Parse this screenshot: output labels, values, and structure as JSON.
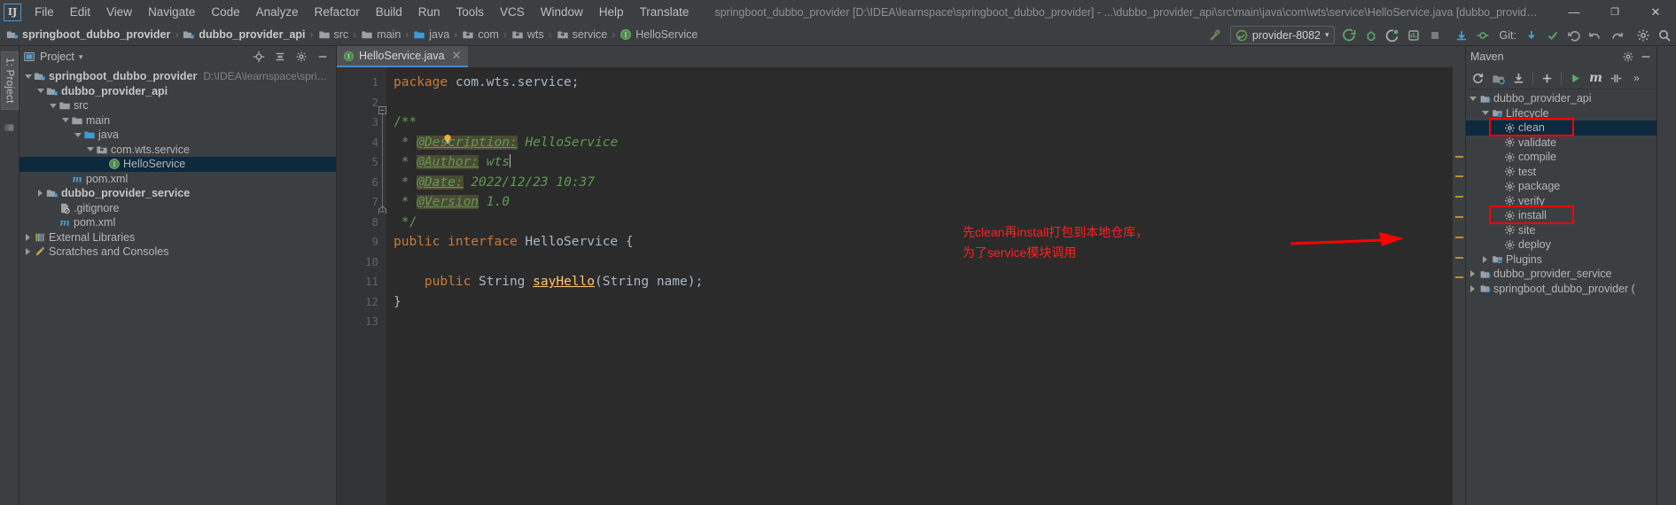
{
  "window": {
    "title": "springboot_dubbo_provider [D:\\IDEA\\learnspace\\springboot_dubbo_provider] - ...\\dubbo_provider_api\\src\\main\\java\\com\\wts\\service\\HelloService.java [dubbo_provider_api]",
    "logo": "IJ",
    "minimize": "—",
    "maximize": "❐",
    "close": "✕"
  },
  "menubar": {
    "items": [
      {
        "label": "File"
      },
      {
        "label": "Edit"
      },
      {
        "label": "View"
      },
      {
        "label": "Navigate"
      },
      {
        "label": "Code"
      },
      {
        "label": "Analyze"
      },
      {
        "label": "Refactor"
      },
      {
        "label": "Build"
      },
      {
        "label": "Run"
      },
      {
        "label": "Tools"
      },
      {
        "label": "VCS"
      },
      {
        "label": "Window"
      },
      {
        "label": "Help"
      },
      {
        "label": "Translate"
      }
    ]
  },
  "navbar": {
    "crumbs": [
      {
        "label": "springboot_dubbo_provider",
        "icon": "module-icon",
        "bold": true
      },
      {
        "label": "dubbo_provider_api",
        "icon": "module-icon",
        "bold": true
      },
      {
        "label": "src",
        "icon": "folder-icon",
        "bold": false
      },
      {
        "label": "main",
        "icon": "folder-icon",
        "bold": false
      },
      {
        "label": "java",
        "icon": "source-folder-icon",
        "bold": false
      },
      {
        "label": "com",
        "icon": "package-icon",
        "bold": false
      },
      {
        "label": "wts",
        "icon": "package-icon",
        "bold": false
      },
      {
        "label": "service",
        "icon": "package-icon",
        "bold": false
      },
      {
        "label": "HelloService",
        "icon": "interface-icon",
        "bold": false
      }
    ],
    "separator": "›",
    "run_config": {
      "label": "provider-8082",
      "icon": "spring-boot-icon",
      "dropdown": "▾"
    },
    "git_label": "Git:",
    "icons": [
      "build-project-icon",
      "run-icon",
      "debug-icon",
      "run-with-coverage-icon",
      "profile-icon",
      "stop-icon",
      "update-project-icon",
      "commit-icon",
      "rollback-icon",
      "undo-icon",
      "redo-icon",
      "open-settings-icon",
      "search-everywhere-icon"
    ]
  },
  "left_rail": {
    "tab": "1: Project",
    "structure_icon": "structure-icon"
  },
  "project_panel": {
    "title": "Project",
    "dropdown": "▾",
    "header_icons": [
      "locate-icon",
      "collapse-all-icon",
      "settings-gear-icon",
      "hide-icon"
    ],
    "tree": [
      {
        "label": "springboot_dubbo_provider",
        "sub": "D:\\IDEA\\learnspace\\springboot_dubbo...",
        "depth": 0,
        "twisty": "down",
        "icon": "module-icon",
        "bold": true,
        "selected": false
      },
      {
        "label": "dubbo_provider_api",
        "sub": "",
        "depth": 1,
        "twisty": "down",
        "icon": "module-icon",
        "bold": true,
        "selected": false
      },
      {
        "label": "src",
        "sub": "",
        "depth": 2,
        "twisty": "down",
        "icon": "folder-icon",
        "bold": false,
        "selected": false
      },
      {
        "label": "main",
        "sub": "",
        "depth": 3,
        "twisty": "down",
        "icon": "folder-icon",
        "bold": false,
        "selected": false
      },
      {
        "label": "java",
        "sub": "",
        "depth": 4,
        "twisty": "down",
        "icon": "source-folder-icon",
        "bold": false,
        "selected": false
      },
      {
        "label": "com.wts.service",
        "sub": "",
        "depth": 5,
        "twisty": "down",
        "icon": "package-icon",
        "bold": false,
        "selected": false
      },
      {
        "label": "HelloService",
        "sub": "",
        "depth": 6,
        "twisty": "none",
        "icon": "interface-icon",
        "bold": false,
        "selected": true
      },
      {
        "label": "pom.xml",
        "sub": "",
        "depth": 3,
        "twisty": "none",
        "icon": "maven-file-icon",
        "bold": false,
        "selected": false
      },
      {
        "label": "dubbo_provider_service",
        "sub": "",
        "depth": 1,
        "twisty": "right",
        "icon": "module-icon",
        "bold": true,
        "selected": false
      },
      {
        "label": ".gitignore",
        "sub": "",
        "depth": 2,
        "twisty": "none",
        "icon": "gitignore-icon",
        "bold": false,
        "selected": false
      },
      {
        "label": "pom.xml",
        "sub": "",
        "depth": 2,
        "twisty": "none",
        "icon": "maven-file-icon",
        "bold": false,
        "selected": false
      },
      {
        "label": "External Libraries",
        "sub": "",
        "depth": 0,
        "twisty": "right",
        "icon": "library-icon",
        "bold": false,
        "selected": false
      },
      {
        "label": "Scratches and Consoles",
        "sub": "",
        "depth": 0,
        "twisty": "right",
        "icon": "scratches-icon",
        "bold": false,
        "selected": false
      }
    ]
  },
  "editor": {
    "tab": {
      "label": "HelloService.java",
      "icon": "interface-icon",
      "close": "✕"
    },
    "line_numbers": [
      "1",
      "2",
      "3",
      "4",
      "5",
      "6",
      "7",
      "8",
      "9",
      "10",
      "11",
      "12",
      "13"
    ],
    "code_lines": [
      {
        "n": 1,
        "segments": [
          {
            "t": "package ",
            "c": "kw"
          },
          {
            "t": "com.wts.service;",
            "c": "txt"
          }
        ]
      },
      {
        "n": 2,
        "segments": []
      },
      {
        "n": 3,
        "segments": [
          {
            "t": "/**",
            "c": "cm"
          }
        ]
      },
      {
        "n": 4,
        "segments": [
          {
            "t": " * ",
            "c": "cm"
          },
          {
            "t": "@Description:",
            "c": "cmu"
          },
          {
            "t": " ",
            "c": "cm"
          },
          {
            "t": "HelloService",
            "c": "cmi"
          }
        ]
      },
      {
        "n": 5,
        "segments": [
          {
            "t": " * ",
            "c": "cm"
          },
          {
            "t": "@Author:",
            "c": "cmu"
          },
          {
            "t": " ",
            "c": "cm"
          },
          {
            "t": "wts",
            "c": "cmi"
          }
        ]
      },
      {
        "n": 6,
        "segments": [
          {
            "t": " * ",
            "c": "cm"
          },
          {
            "t": "@Date:",
            "c": "cmu"
          },
          {
            "t": " ",
            "c": "cm"
          },
          {
            "t": "2022/12/23 10:37",
            "c": "cmi"
          }
        ]
      },
      {
        "n": 7,
        "segments": [
          {
            "t": " * ",
            "c": "cm"
          },
          {
            "t": "@Version",
            "c": "cmu"
          },
          {
            "t": " ",
            "c": "cm"
          },
          {
            "t": "1.0",
            "c": "cmi"
          }
        ]
      },
      {
        "n": 8,
        "segments": [
          {
            "t": " */",
            "c": "cm"
          }
        ]
      },
      {
        "n": 9,
        "segments": [
          {
            "t": "public interface ",
            "c": "kw"
          },
          {
            "t": "HelloService {",
            "c": "txt"
          }
        ]
      },
      {
        "n": 10,
        "segments": []
      },
      {
        "n": 11,
        "segments": [
          {
            "t": "    ",
            "c": "txt"
          },
          {
            "t": "public ",
            "c": "kw"
          },
          {
            "t": "String ",
            "c": "txt"
          },
          {
            "t": "sayHello",
            "c": "mth"
          },
          {
            "t": "(",
            "c": "txt"
          },
          {
            "t": "String ",
            "c": "txt"
          },
          {
            "t": "name);",
            "c": "txt"
          }
        ]
      },
      {
        "n": 12,
        "segments": [
          {
            "t": "}",
            "c": "txt"
          }
        ]
      },
      {
        "n": 13,
        "segments": []
      }
    ],
    "intention_bulb": "lightbulb-icon",
    "caret_line": 5,
    "annotation": {
      "line1": "先clean再install打包到本地仓库，",
      "line2": "为了service模块调用",
      "color": "#ff1f1f"
    }
  },
  "maven_panel": {
    "title": "Maven",
    "header_icons": [
      "settings-gear-icon",
      "hide-icon"
    ],
    "toolbar_icons": [
      "reload-icon",
      "generate-sources-icon",
      "download-sources-icon",
      "add-maven-project-icon",
      "run-maven-goal-icon",
      "maven-settings-icon",
      "toggle-offline-icon",
      "more-icon"
    ],
    "tree": [
      {
        "label": "dubbo_provider_api",
        "depth": 0,
        "twisty": "down",
        "icon": "maven-project-icon",
        "selected": false,
        "boxed": false
      },
      {
        "label": "Lifecycle",
        "depth": 1,
        "twisty": "down",
        "icon": "lifecycle-folder-icon",
        "selected": false,
        "boxed": false
      },
      {
        "label": "clean",
        "depth": 2,
        "twisty": "none",
        "icon": "maven-goal-icon",
        "selected": true,
        "boxed": true
      },
      {
        "label": "validate",
        "depth": 2,
        "twisty": "none",
        "icon": "maven-goal-icon",
        "selected": false,
        "boxed": false
      },
      {
        "label": "compile",
        "depth": 2,
        "twisty": "none",
        "icon": "maven-goal-icon",
        "selected": false,
        "boxed": false
      },
      {
        "label": "test",
        "depth": 2,
        "twisty": "none",
        "icon": "maven-goal-icon",
        "selected": false,
        "boxed": false
      },
      {
        "label": "package",
        "depth": 2,
        "twisty": "none",
        "icon": "maven-goal-icon",
        "selected": false,
        "boxed": false
      },
      {
        "label": "verify",
        "depth": 2,
        "twisty": "none",
        "icon": "maven-goal-icon",
        "selected": false,
        "boxed": false
      },
      {
        "label": "install",
        "depth": 2,
        "twisty": "none",
        "icon": "maven-goal-icon",
        "selected": false,
        "boxed": true
      },
      {
        "label": "site",
        "depth": 2,
        "twisty": "none",
        "icon": "maven-goal-icon",
        "selected": false,
        "boxed": false
      },
      {
        "label": "deploy",
        "depth": 2,
        "twisty": "none",
        "icon": "maven-goal-icon",
        "selected": false,
        "boxed": false
      },
      {
        "label": "Plugins",
        "depth": 1,
        "twisty": "right",
        "icon": "lifecycle-folder-icon",
        "selected": false,
        "boxed": false
      },
      {
        "label": "dubbo_provider_service",
        "depth": 0,
        "twisty": "right",
        "icon": "maven-project-icon",
        "selected": false,
        "boxed": false
      },
      {
        "label": "springboot_dubbo_provider (",
        "depth": 0,
        "twisty": "right",
        "icon": "maven-project-icon",
        "selected": false,
        "boxed": false
      }
    ]
  },
  "colors": {
    "accent_blue": "#4a88c7",
    "selection": "#0d293e",
    "annotation_red": "#ff0000",
    "panel_bg": "#3c3f41",
    "editor_bg": "#2b2b2b",
    "gutter_bg": "#313335"
  }
}
